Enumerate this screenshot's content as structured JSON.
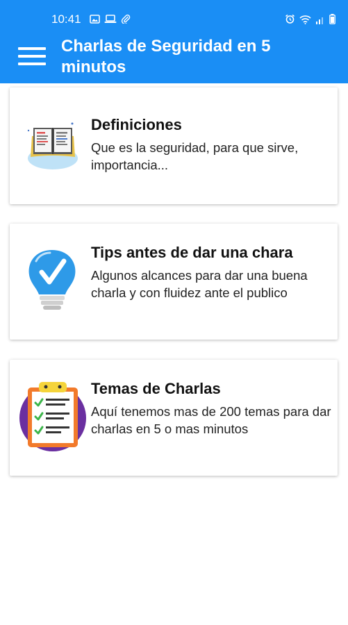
{
  "status_bar": {
    "time": "10:41",
    "left_icons": [
      "gallery-icon",
      "laptop-icon",
      "paperclip-icon"
    ],
    "right_icons": [
      "alarm-icon",
      "wifi-icon",
      "signal-icon",
      "battery-icon"
    ]
  },
  "app_bar": {
    "title": "Charlas de Seguridad en 5 minutos",
    "menu_icon": "hamburger-menu-icon",
    "color": "#1a8ef5"
  },
  "cards": [
    {
      "title": "Definiciones",
      "description": "Que es la seguridad, para que sirve, importancia...",
      "icon": "open-book-icon"
    },
    {
      "title": "Tips antes de dar una chara",
      "description": "Algunos alcances para dar una buena charla y con fluidez ante el publico",
      "icon": "lightbulb-check-icon"
    },
    {
      "title": "Temas de Charlas",
      "description": "Aquí tenemos mas de 200 temas para dar charlas en 5 o mas minutos",
      "icon": "checklist-clipboard-icon"
    }
  ]
}
